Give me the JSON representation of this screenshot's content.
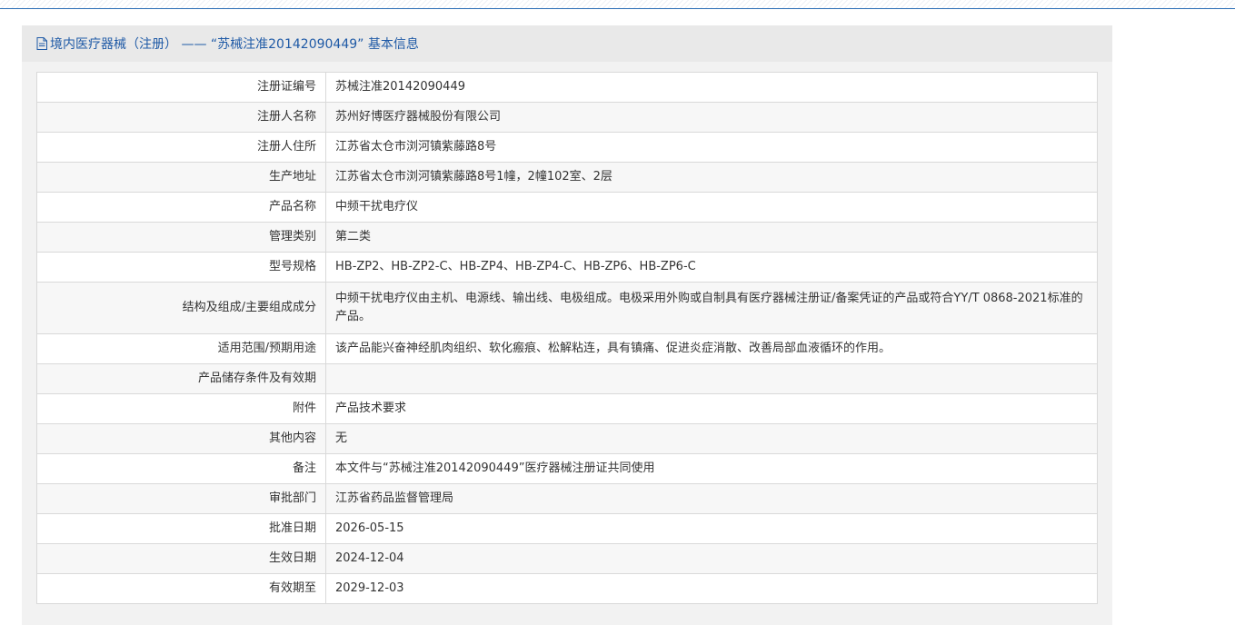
{
  "header": {
    "title": "境内医疗器械（注册） —— “苏械注准20142090449” 基本信息"
  },
  "rows": [
    {
      "label": "注册证编号",
      "value": "苏械注准20142090449"
    },
    {
      "label": "注册人名称",
      "value": "苏州好博医疗器械股份有限公司"
    },
    {
      "label": "注册人住所",
      "value": "江苏省太仓市浏河镇紫藤路8号"
    },
    {
      "label": "生产地址",
      "value": "江苏省太仓市浏河镇紫藤路8号1幢，2幢102室、2层"
    },
    {
      "label": "产品名称",
      "value": "中频干扰电疗仪"
    },
    {
      "label": "管理类别",
      "value": "第二类"
    },
    {
      "label": "型号规格",
      "value": "HB-ZP2、HB-ZP2-C、HB-ZP4、HB-ZP4-C、HB-ZP6、HB-ZP6-C"
    },
    {
      "label": "结构及组成/主要组成成分",
      "value": "中频干扰电疗仪由主机、电源线、输出线、电极组成。电极采用外购或自制具有医疗器械注册证/备案凭证的产品或符合YY/T 0868-2021标准的产品。"
    },
    {
      "label": "适用范围/预期用途",
      "value": "该产品能兴奋神经肌肉组织、软化瘢痕、松解粘连，具有镇痛、促进炎症消散、改善局部血液循环的作用。"
    },
    {
      "label": "产品储存条件及有效期",
      "value": ""
    },
    {
      "label": "附件",
      "value": "产品技术要求"
    },
    {
      "label": "其他内容",
      "value": "无"
    },
    {
      "label": "备注",
      "value": "本文件与“苏械注准20142090449”医疗器械注册证共同使用"
    },
    {
      "label": "审批部门",
      "value": "江苏省药品监督管理局"
    },
    {
      "label": "批准日期",
      "value": "2026-05-15"
    },
    {
      "label": "生效日期",
      "value": "2024-12-04"
    },
    {
      "label": "有效期至",
      "value": "2029-12-03"
    }
  ]
}
